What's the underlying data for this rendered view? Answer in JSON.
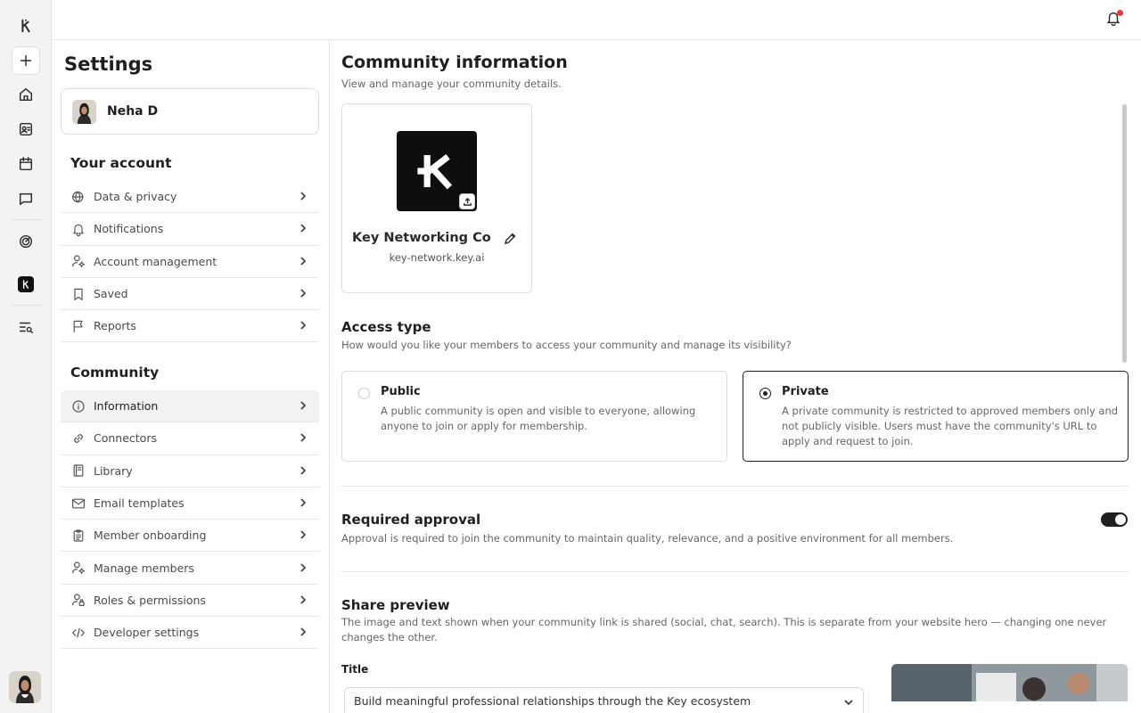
{
  "settings": {
    "title": "Settings",
    "profile_name": "Neha D",
    "account_group": "Your account",
    "account_items": [
      {
        "label": "Data & privacy",
        "icon": "globe-lock-icon"
      },
      {
        "label": "Notifications",
        "icon": "bell-icon"
      },
      {
        "label": "Account management",
        "icon": "user-gear-icon"
      },
      {
        "label": "Saved",
        "icon": "bookmark-icon"
      },
      {
        "label": "Reports",
        "icon": "flag-icon"
      }
    ],
    "community_group": "Community",
    "community_items": [
      {
        "label": "Information",
        "icon": "info-icon"
      },
      {
        "label": "Connectors",
        "icon": "link-icon"
      },
      {
        "label": "Library",
        "icon": "book-icon"
      },
      {
        "label": "Email templates",
        "icon": "mail-icon"
      },
      {
        "label": "Member onboarding",
        "icon": "clipboard-icon"
      },
      {
        "label": "Manage members",
        "icon": "user-gear-icon"
      },
      {
        "label": "Roles & permissions",
        "icon": "user-lock-icon"
      },
      {
        "label": "Developer settings",
        "icon": "code-icon"
      }
    ]
  },
  "main": {
    "title": "Community information",
    "subtitle": "View and manage your community details.",
    "community_name": "Key Networking Co...",
    "community_url": "key-network.key.ai",
    "access": {
      "title": "Access type",
      "desc": "How would you like your members to access your community and manage its visibility?",
      "public_title": "Public",
      "public_desc": "A public community is open and visible to everyone, allowing anyone to join or apply for membership.",
      "private_title": "Private",
      "private_desc": "A private community is restricted to approved members only and not publicly visible. Users must have the community's URL to apply and request to join.",
      "selected": "Private"
    },
    "approval": {
      "title": "Required approval",
      "desc": "Approval is required to join the community to maintain quality, relevance, and a positive environment for all members.",
      "enabled": true
    },
    "share": {
      "title": "Share preview",
      "desc": "The image and text shown when your community link is shared (social, chat, search). This is separate from your website hero — changing one never changes the other.",
      "field_label": "Title",
      "field_value": "Build meaningful professional relationships through the Key ecosystem"
    }
  },
  "colors": {
    "accent": "#1f1f1f",
    "notification_dot": "#e23b3b"
  }
}
